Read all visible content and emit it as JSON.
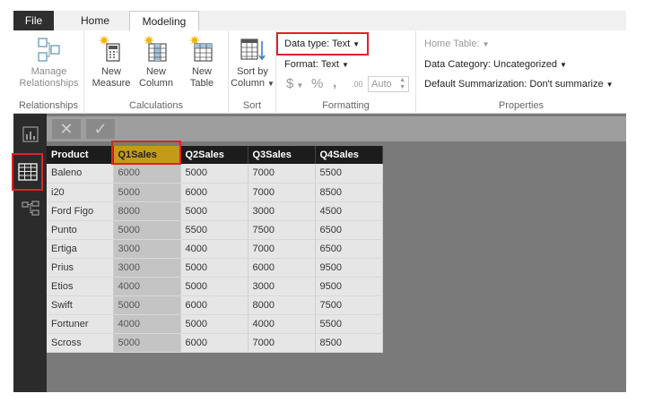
{
  "tabs": {
    "file": "File",
    "home": "Home",
    "modeling": "Modeling"
  },
  "ribbon": {
    "relationships": {
      "button_line1": "Manage",
      "button_line2": "Relationships",
      "group": "Relationships"
    },
    "calculations": {
      "new_measure_line1": "New",
      "new_measure_line2": "Measure",
      "new_column_line1": "New",
      "new_column_line2": "Column",
      "new_table_line1": "New",
      "new_table_line2": "Table",
      "group": "Calculations"
    },
    "sort": {
      "line1": "Sort by",
      "line2": "Column",
      "group": "Sort"
    },
    "formatting": {
      "data_type": "Data type: Text",
      "format": "Format: Text",
      "currency_symbol": "$",
      "percent_symbol": "%",
      "comma_symbol": ",",
      "decimals_symbol": ".00",
      "auto_value": "Auto",
      "group": "Formatting"
    },
    "properties": {
      "home_table": "Home Table:",
      "data_category": "Data Category: Uncategorized",
      "default_summarization": "Default Summarization: Don't summarize",
      "group": "Properties"
    }
  },
  "formula_bar": {
    "cancel": "✕",
    "commit": "✓"
  },
  "table": {
    "columns": [
      "Product",
      "Q1Sales",
      "Q2Sales",
      "Q3Sales",
      "Q4Sales"
    ],
    "rows": [
      [
        "Baleno",
        "6000",
        "5000",
        "7000",
        "5500"
      ],
      [
        "i20",
        "5000",
        "6000",
        "7000",
        "8500"
      ],
      [
        "Ford Figo",
        "8000",
        "5000",
        "3000",
        "4500"
      ],
      [
        "Punto",
        "5000",
        "5500",
        "7500",
        "6500"
      ],
      [
        "Ertiga",
        "3000",
        "4000",
        "7000",
        "6500"
      ],
      [
        "Prius",
        "3000",
        "5000",
        "6000",
        "9500"
      ],
      [
        "Etios",
        "4000",
        "5000",
        "3000",
        "9500"
      ],
      [
        "Swift",
        "5000",
        "6000",
        "8000",
        "7500"
      ],
      [
        "Fortuner",
        "4000",
        "5000",
        "4000",
        "5500"
      ],
      [
        "Scross",
        "5000",
        "6000",
        "7000",
        "8500"
      ]
    ],
    "selected_column": 1
  },
  "colors": {
    "highlight_red": "#e0202a",
    "selected_header": "#c59a1a",
    "dark": "#2b2b2b"
  }
}
